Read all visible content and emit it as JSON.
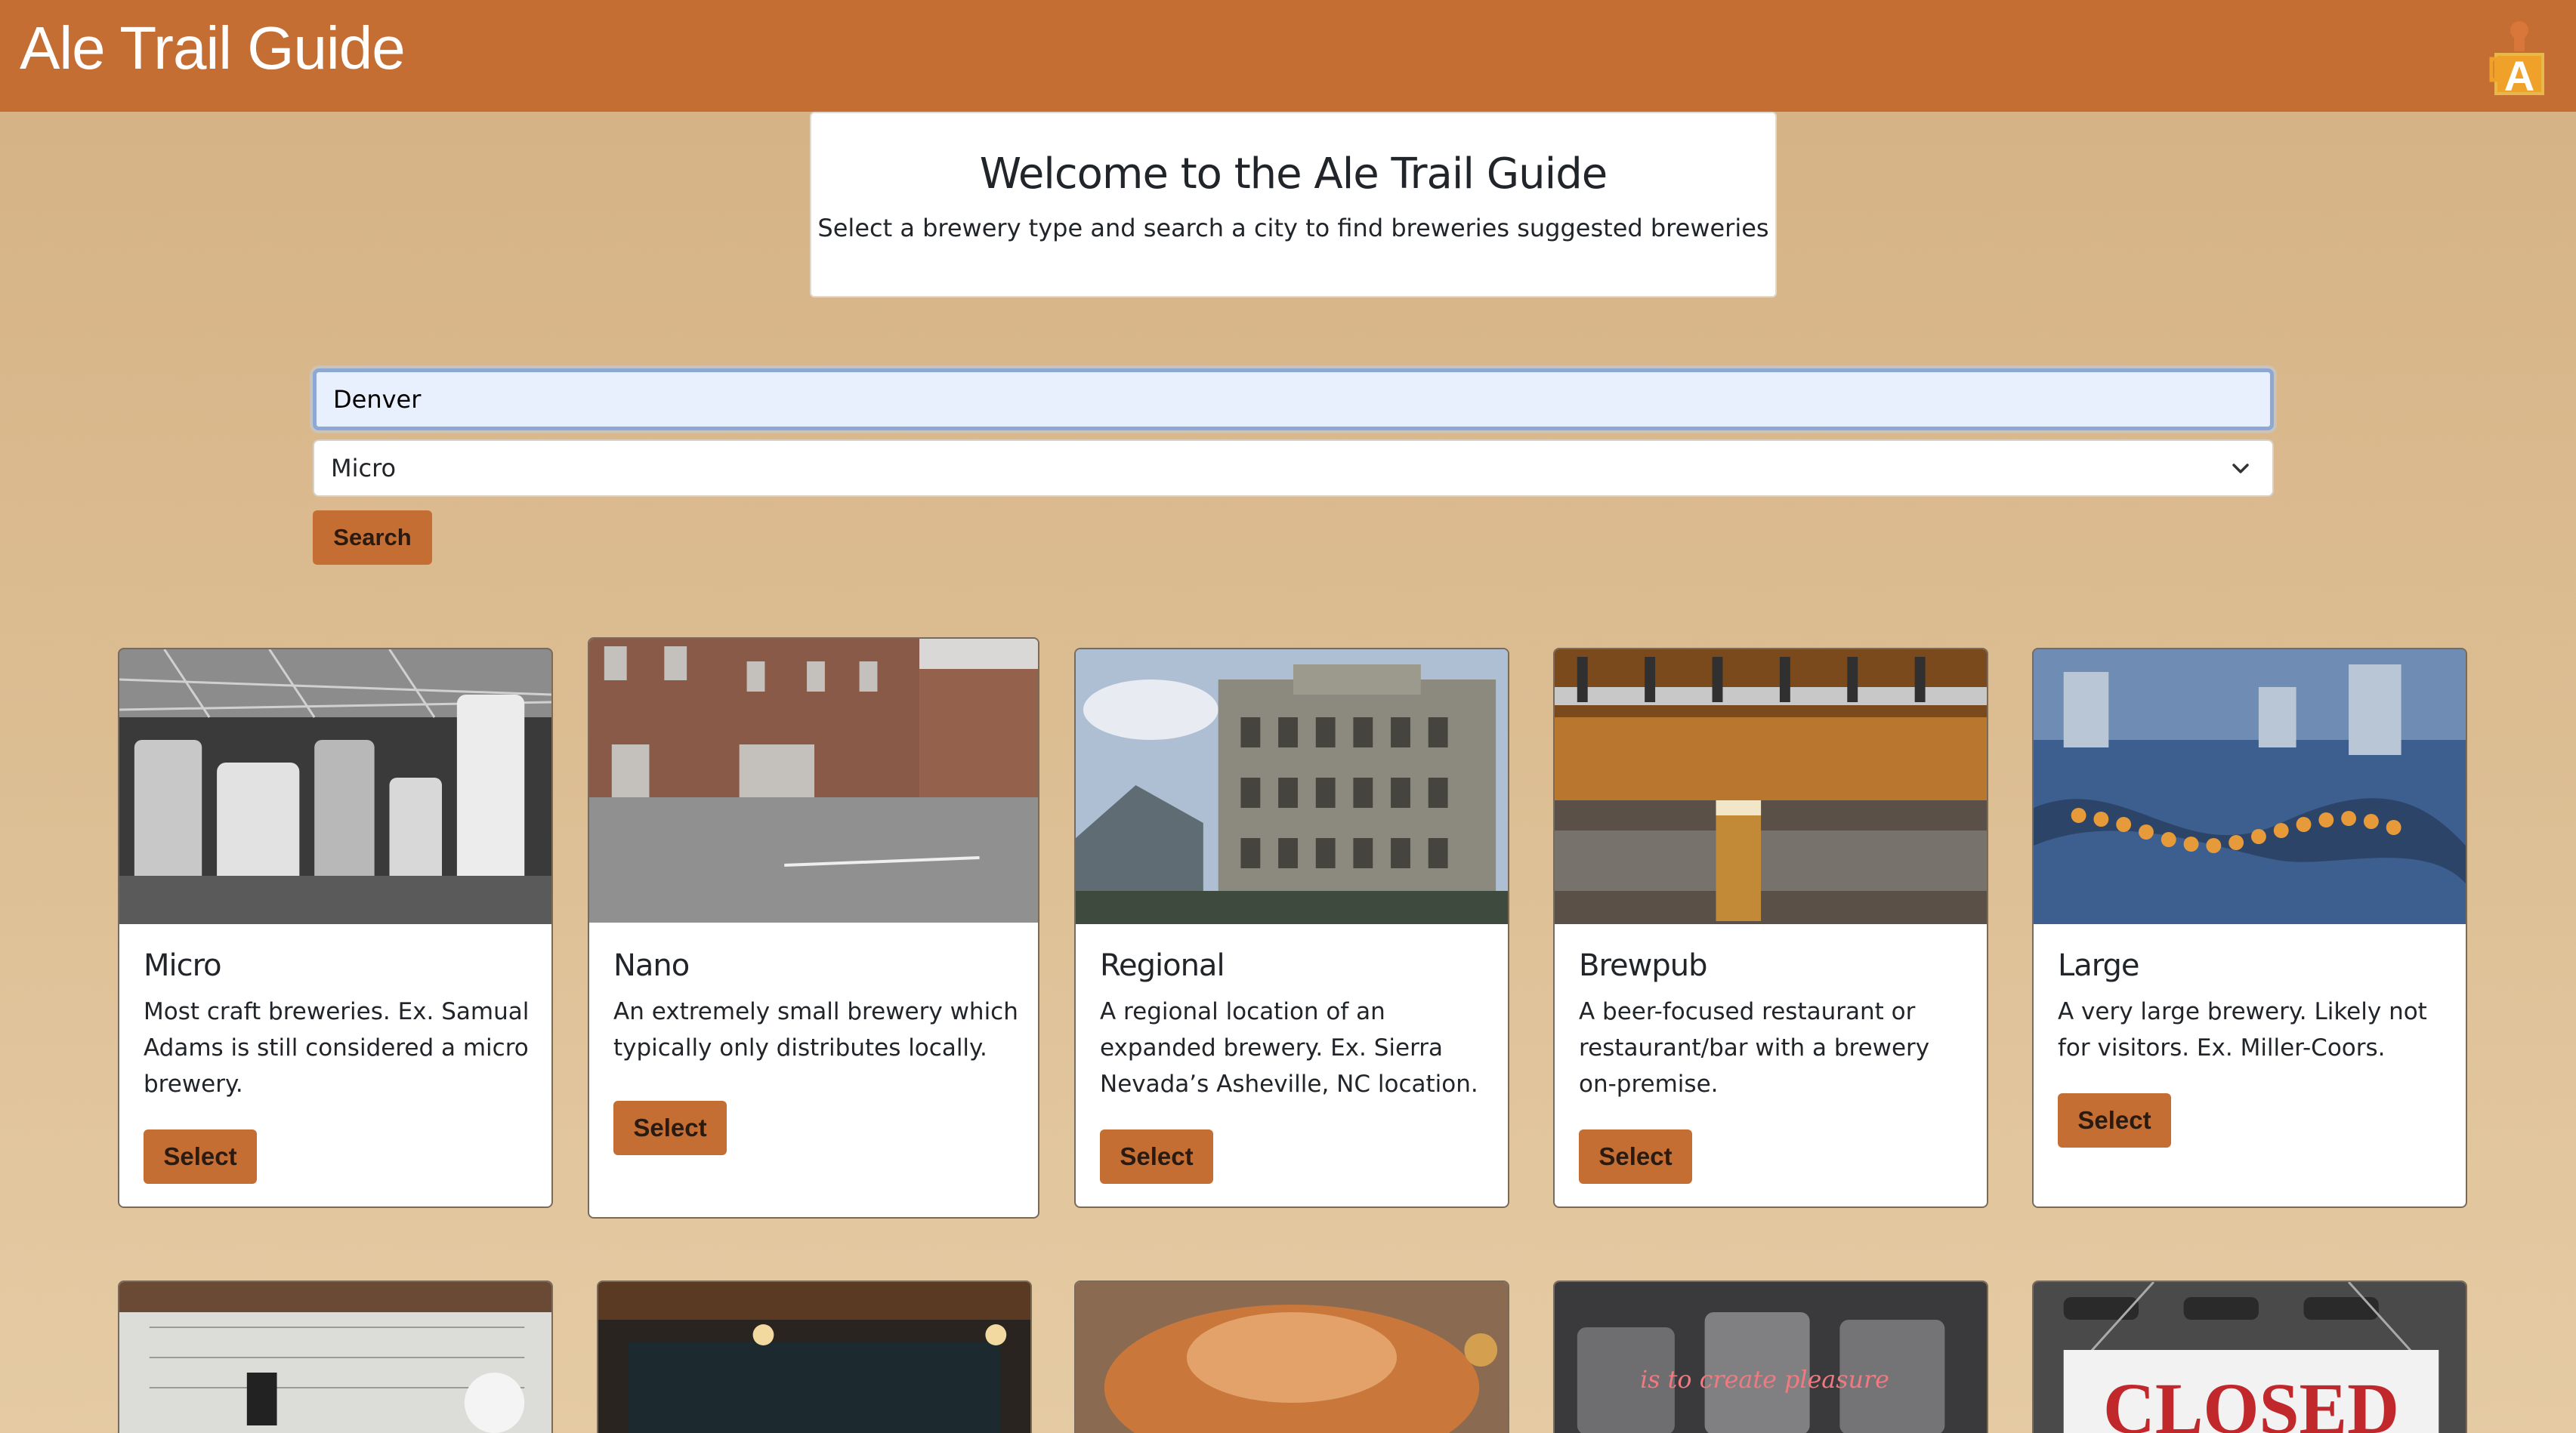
{
  "header": {
    "brand": "Ale Trail Guide",
    "logo_letter": "A"
  },
  "welcome": {
    "title": "Welcome to the Ale Trail Guide",
    "subtitle": "Select a brewery type and search a city to find breweries suggested breweries"
  },
  "search": {
    "city_value": "Denver",
    "type_value": "Micro",
    "button_label": "Search"
  },
  "cards": [
    {
      "title": "Micro",
      "description": "Most craft breweries. Ex. Samual Adams is still considered a micro brewery.",
      "button": "Select"
    },
    {
      "title": "Nano",
      "description": "An extremely small brewery which typically only distributes locally.",
      "button": "Select"
    },
    {
      "title": "Regional",
      "description": "A regional location of an expanded brewery. Ex. Sierra Nevada’s Asheville, NC location.",
      "button": "Select"
    },
    {
      "title": "Brewpub",
      "description": "A beer-focused restaurant or restaurant/bar with a brewery on-premise.",
      "button": "Select"
    },
    {
      "title": "Large",
      "description": "A very large brewery. Likely not for visitors. Ex. Miller-Coors.",
      "button": "Select"
    }
  ],
  "second_row_images": [
    "blueprint-tools",
    "dim-bar-interior",
    "copper-kettle",
    "tanks-neon-sign",
    "closed-sign"
  ],
  "second_row_texts": {
    "neon": "is to create pleasure",
    "closed": "CLOSED"
  },
  "colors": {
    "accent": "#c46e33",
    "page_bg": "#d4b184"
  }
}
